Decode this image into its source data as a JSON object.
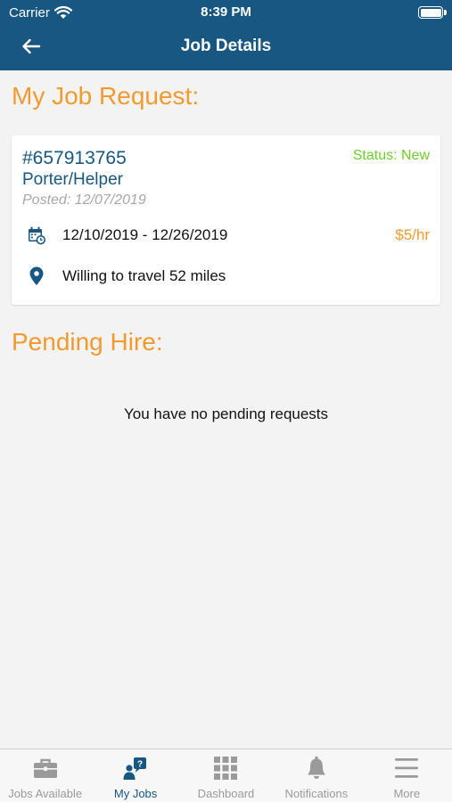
{
  "status_bar": {
    "carrier": "Carrier",
    "time": "8:39 PM"
  },
  "header": {
    "title": "Job Details"
  },
  "job_request": {
    "section_title": "My Job Request:",
    "job_id": "#657913765",
    "status": "Status: New",
    "title": "Porter/Helper",
    "posted": "Posted: 12/07/2019",
    "dates": "12/10/2019 - 12/26/2019",
    "rate": "$5/hr",
    "travel": "Willing to travel 52 miles"
  },
  "pending": {
    "section_title": "Pending Hire:",
    "empty_message": "You have no pending requests"
  },
  "tabs": [
    {
      "label": "Jobs Available",
      "icon": "briefcase-icon",
      "active": false
    },
    {
      "label": "My Jobs",
      "icon": "my-jobs-icon",
      "active": true
    },
    {
      "label": "Dashboard",
      "icon": "grid-icon",
      "active": false
    },
    {
      "label": "Notifications",
      "icon": "bell-icon",
      "active": false
    },
    {
      "label": "More",
      "icon": "menu-icon",
      "active": false
    }
  ],
  "colors": {
    "header": "#175782",
    "accent_orange": "#f29a2e",
    "status_green": "#6fcf2c",
    "tab_active": "#175782",
    "tab_inactive": "#9a9a9a"
  }
}
